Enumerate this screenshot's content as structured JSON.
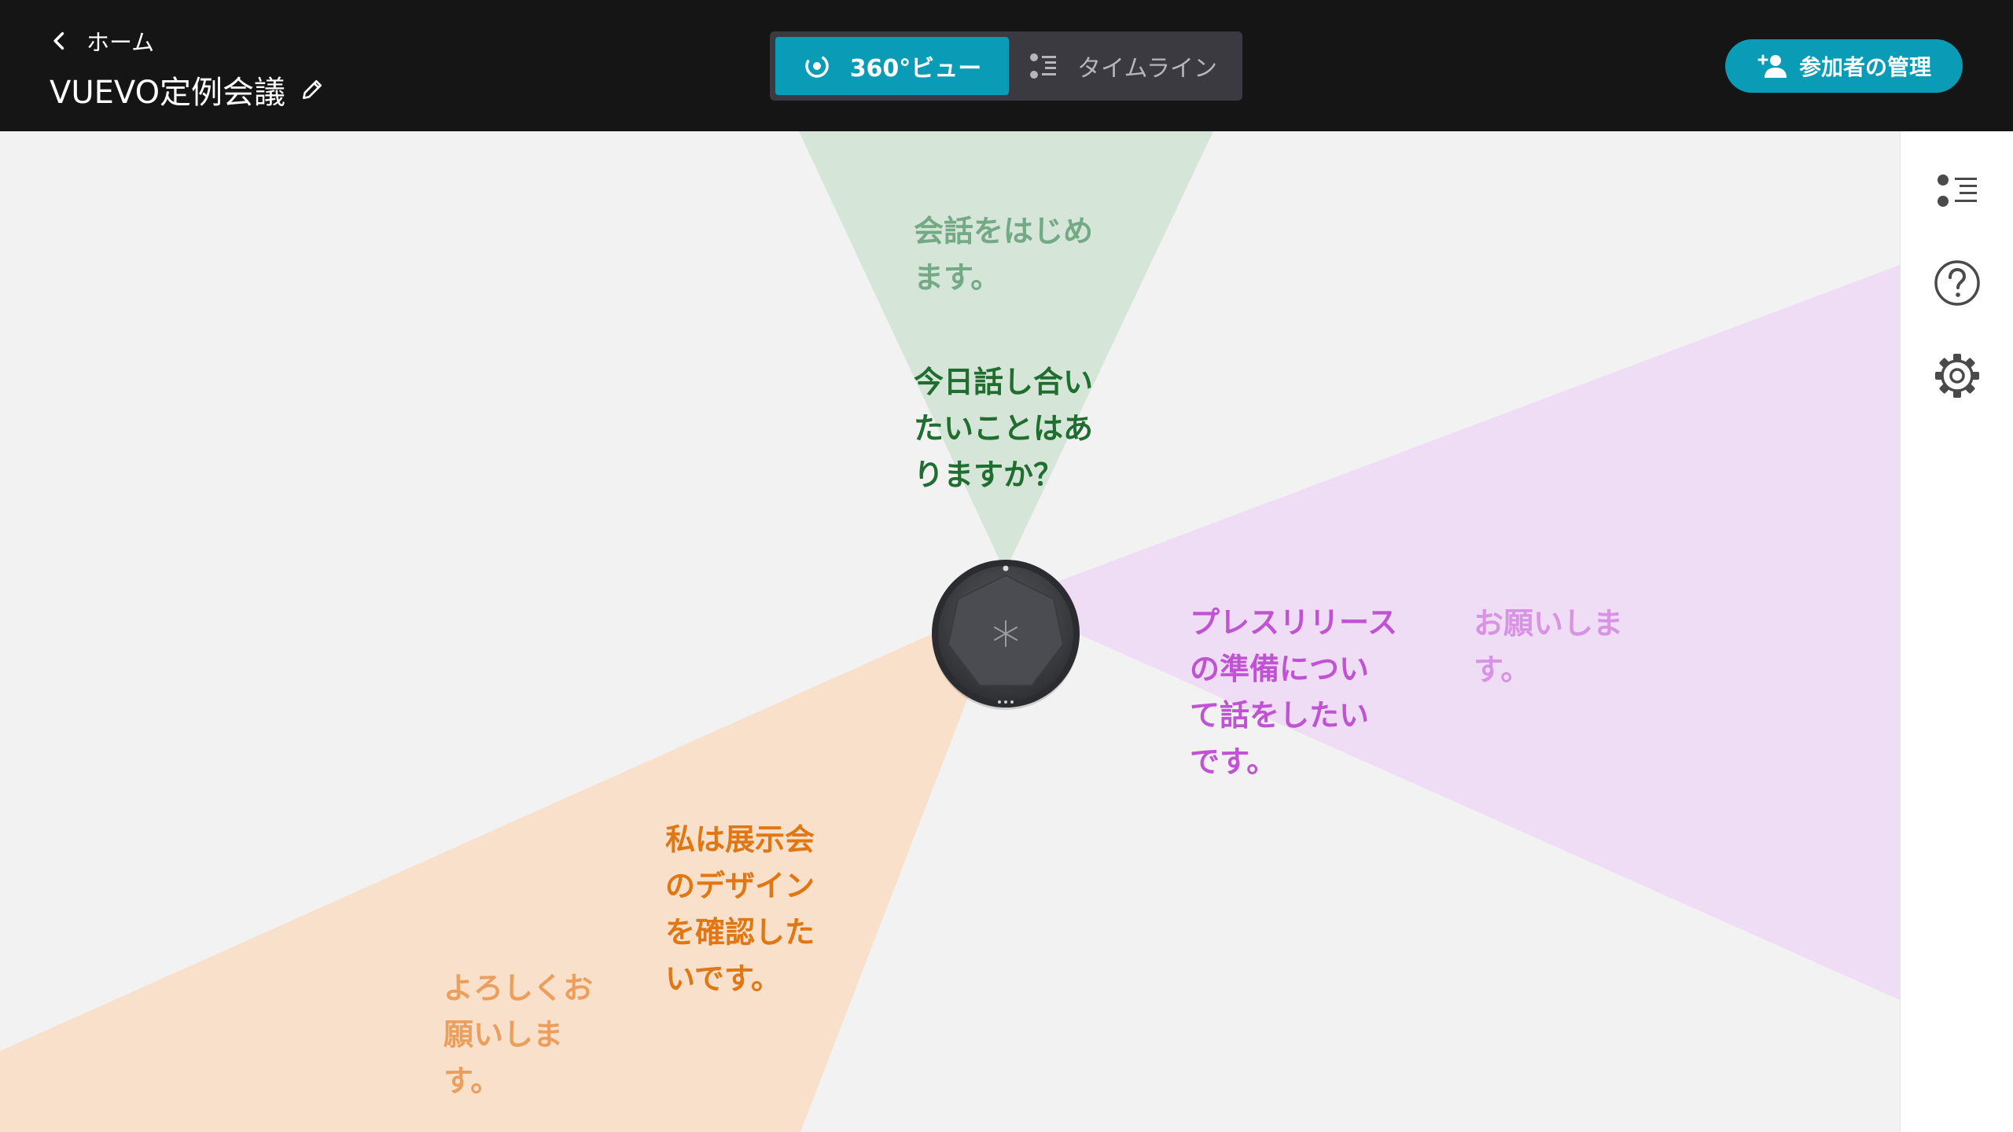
{
  "header": {
    "back_label": "ホーム",
    "meeting_title": "VUEVO定例会議",
    "view_tabs": [
      {
        "label": "360°ビュー",
        "active": true
      },
      {
        "label": "タイムライン",
        "active": false
      }
    ],
    "manage_participants_label": "参加者の管理"
  },
  "colors": {
    "accent": "#0a9cb7",
    "top_bar": "#151515",
    "speaker_green": "#2e7d32",
    "speaker_purple": "#c255d6",
    "speaker_orange": "#e27b15"
  },
  "utterances": {
    "green_older": "会話をはじめ\nます。",
    "green_latest": "今日話し合い\nたいことはあ\nりますか？",
    "purple_latest": "プレスリリース\nの準備につい\nて話をしたい\nです。",
    "purple_older": "お願いしま\nす。",
    "orange_latest": "私は展示会\nのデザイン\nを確認した\nいです。",
    "orange_older": "よろしくお\n願いしま\nす。"
  },
  "rail_icons": [
    "list-icon",
    "help-icon",
    "settings-icon"
  ]
}
